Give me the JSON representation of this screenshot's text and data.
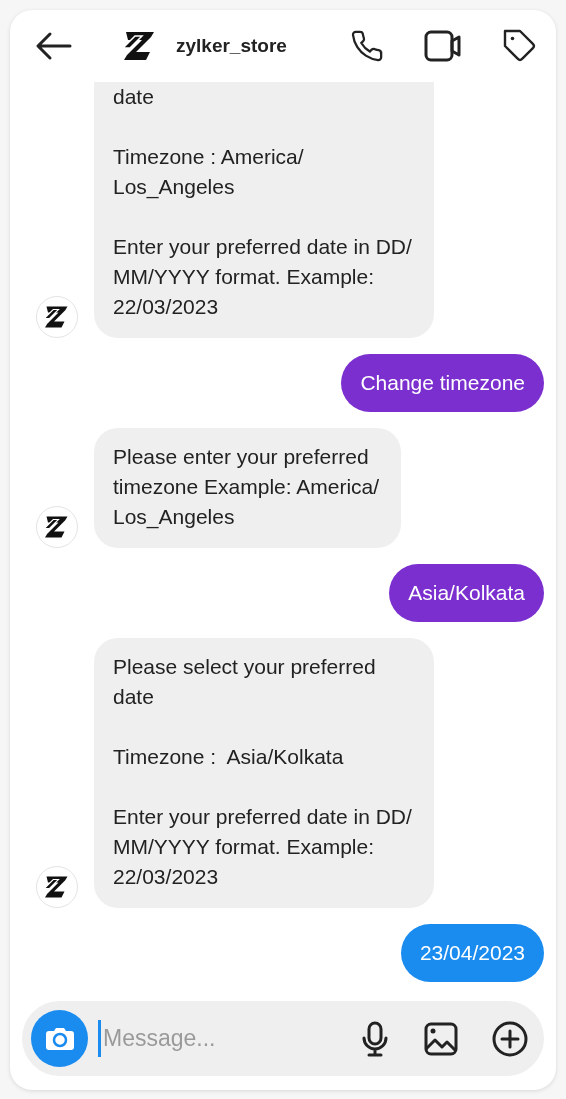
{
  "header": {
    "title": "zylker_store"
  },
  "messages": [
    {
      "kind": "incoming",
      "text": "date\n\nTimezone : America/\nLos_Angeles\n\nEnter your preferred date in DD/\nMM/YYYY format. Example:\n22/03/2023"
    },
    {
      "kind": "outgoing",
      "text": "Change timezone",
      "color": "#7b2fcf"
    },
    {
      "kind": "incoming",
      "text": "Please enter your preferred\ntimezone Example: America/\nLos_Angeles"
    },
    {
      "kind": "outgoing",
      "text": "Asia/Kolkata",
      "color": "#7b2fcf"
    },
    {
      "kind": "incoming",
      "text": "Please select your preferred\ndate\n\nTimezone :  Asia/Kolkata\n\nEnter your preferred date in DD/\nMM/YYYY format. Example:\n22/03/2023"
    },
    {
      "kind": "outgoing",
      "text": "23/04/2023",
      "color": "#1a8cf0"
    }
  ],
  "composer": {
    "placeholder": "Message..."
  }
}
